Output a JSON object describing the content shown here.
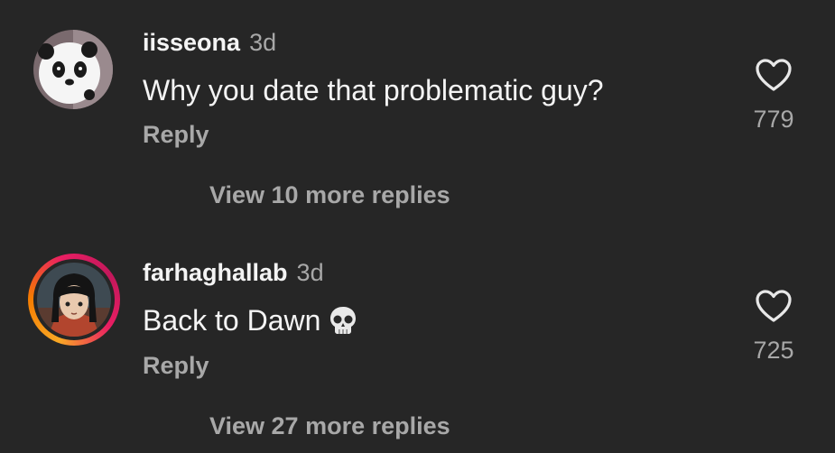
{
  "comments": [
    {
      "username": "iisseona",
      "time": "3d",
      "text": "Why you date that problematic guy?",
      "reply_label": "Reply",
      "likes": "779",
      "view_more": "View 10 more replies",
      "avatar_icon": "panda-avatar"
    },
    {
      "username": "farhaghallab",
      "time": "3d",
      "text": "Back to Dawn",
      "emoji": "skull-emoji",
      "reply_label": "Reply",
      "likes": "725",
      "view_more": "View 27 more replies",
      "avatar_icon": "anime-girl-avatar",
      "has_story_ring": true
    }
  ],
  "colors": {
    "background": "#262626",
    "primary_text": "#f4f4f4",
    "secondary_text": "#a8a8a8",
    "story_ring": [
      "#f9a825",
      "#e91e63"
    ]
  }
}
